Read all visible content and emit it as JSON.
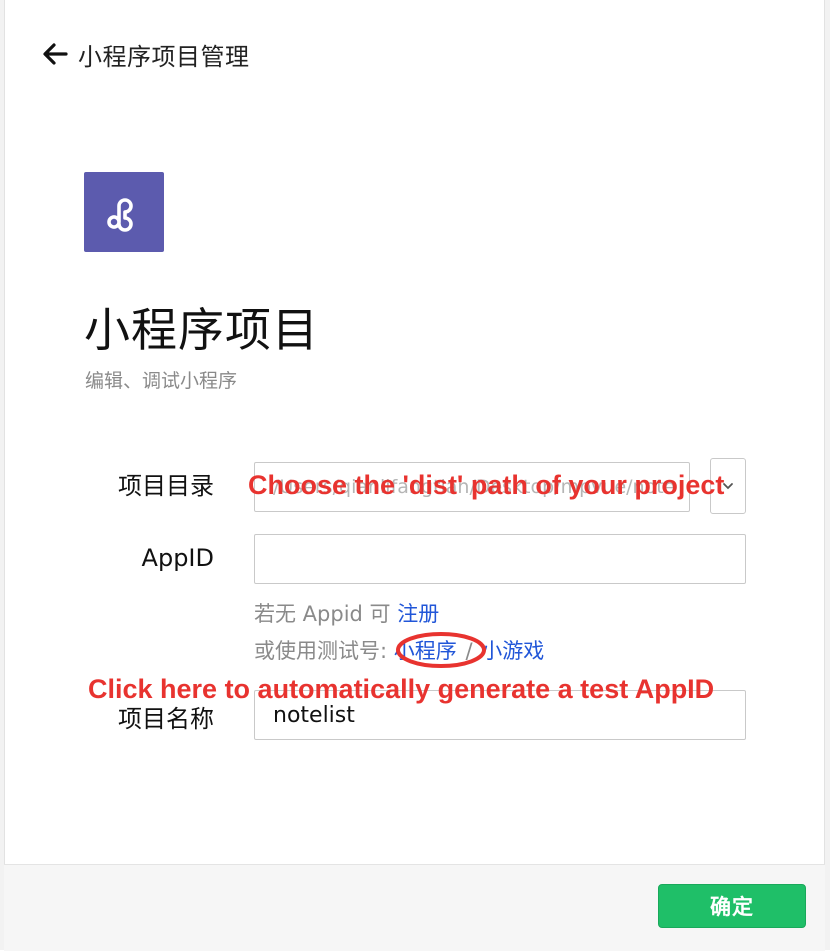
{
  "header": {
    "title": "小程序项目管理",
    "back_icon": "arrow-left-icon"
  },
  "app": {
    "logo_icon": "mini-program-link-icon",
    "logo_color": "#5c5bae",
    "title": "小程序项目",
    "subtitle": "编辑、调试小程序"
  },
  "form": {
    "project_dir": {
      "label": "项目目录",
      "placeholder": "/Users/qianlifangtian/Desktop/mpvue/note",
      "browse_icon": "chevron-down-icon"
    },
    "appid": {
      "label": "AppID",
      "value": ""
    },
    "hint_register": {
      "prefix": "若无 Appid 可",
      "link": "注册"
    },
    "hint_test": {
      "prefix": "或使用测试号:",
      "link_mini": "小程序",
      "separator": "/",
      "link_game": "小游戏"
    },
    "project_name": {
      "label": "项目名称",
      "value": "notelist"
    }
  },
  "annotations": {
    "dir_note": "Choose the 'dist' path of your project",
    "appid_note": "Click here to automatically generate a test AppID",
    "color": "#e8332f"
  },
  "footer": {
    "confirm_label": "确定",
    "confirm_color": "#1fbf68"
  }
}
